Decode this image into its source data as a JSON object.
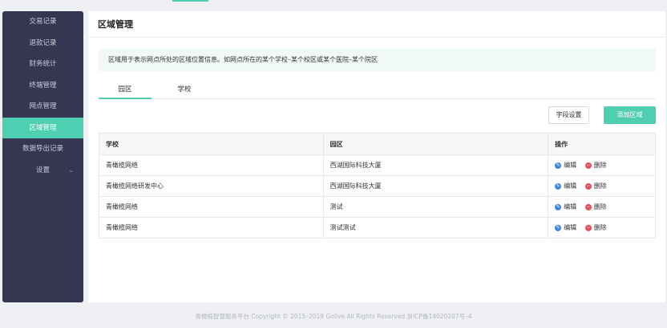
{
  "sidebar": {
    "items": [
      {
        "label": "交易记录"
      },
      {
        "label": "退款记录"
      },
      {
        "label": "财务统计"
      },
      {
        "label": "终端管理"
      },
      {
        "label": "网点管理"
      },
      {
        "label": "区域管理"
      },
      {
        "label": "数据导出记录"
      },
      {
        "label": "设置"
      }
    ],
    "active_index": 5
  },
  "header": {
    "title": "区域管理"
  },
  "notice": {
    "text": "区域用于表示网点所处的区域位置信息。如网点所在的某个学校–某个校区或某个医院–某个院区"
  },
  "tabs": [
    {
      "label": "园区"
    },
    {
      "label": "学校"
    }
  ],
  "toolbar": {
    "fields_label": "字段设置",
    "add_label": "添加区域"
  },
  "table": {
    "headers": [
      "学校",
      "园区",
      "操作"
    ],
    "rows": [
      {
        "school": "青橄榄网络",
        "park": "西湖国际科技大厦"
      },
      {
        "school": "青橄榄网络研发中心",
        "park": "西湖国际科技大厦"
      },
      {
        "school": "青橄榄网络",
        "park": "测试"
      },
      {
        "school": "青橄榄网络",
        "park": "测试测试"
      }
    ],
    "edit_label": "编辑",
    "delete_label": "删除"
  },
  "footer": {
    "text": "青橄榄智慧服务平台 Copyright © 2015–2019 Golive All Rights Reserved  浙ICP备14020207号–4"
  },
  "colors": {
    "accent": "#4ecfb1",
    "sidebar_bg": "#353652",
    "edit_icon": "#3d86d8",
    "delete_icon": "#e8505b"
  }
}
